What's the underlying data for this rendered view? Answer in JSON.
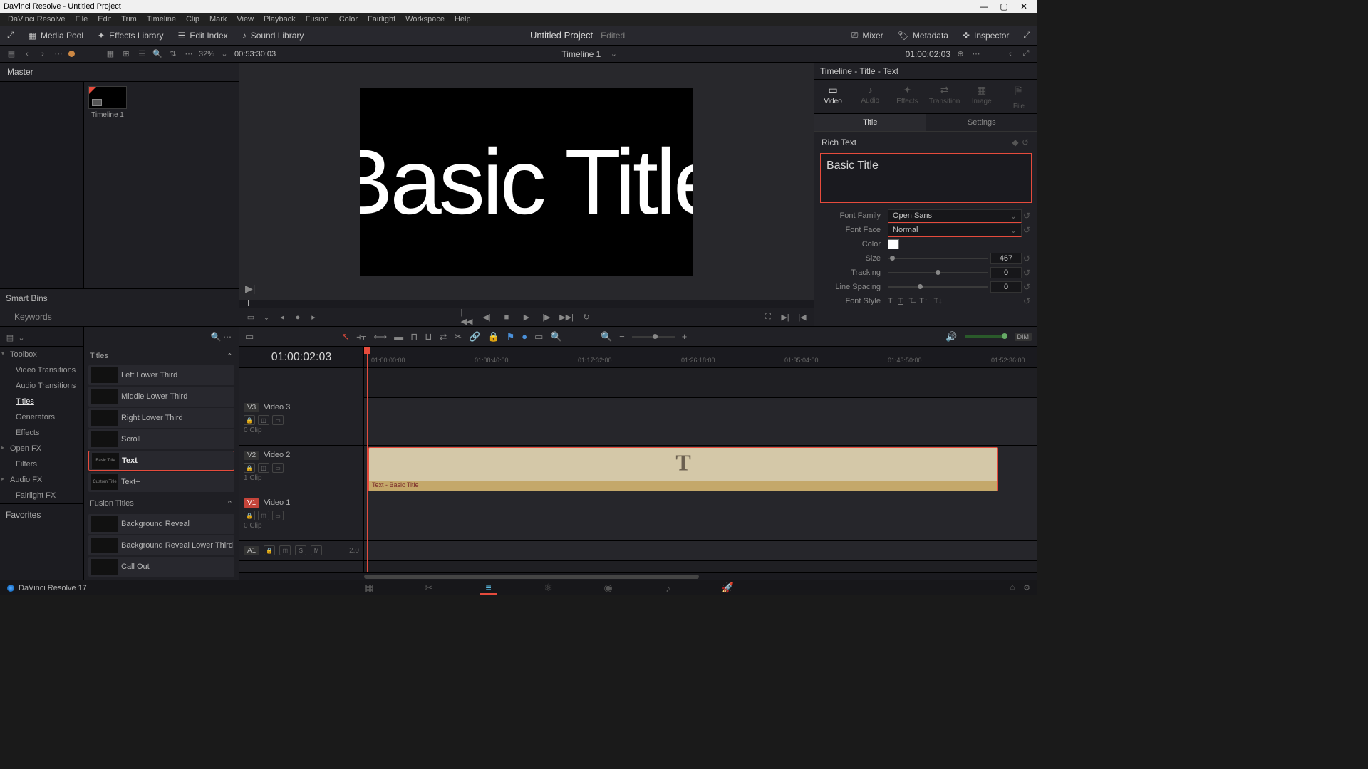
{
  "window": {
    "title": "DaVinci Resolve - Untitled Project"
  },
  "menus": [
    "DaVinci Resolve",
    "File",
    "Edit",
    "Trim",
    "Timeline",
    "Clip",
    "Mark",
    "View",
    "Playback",
    "Fusion",
    "Color",
    "Fairlight",
    "Workspace",
    "Help"
  ],
  "panels": {
    "mediaPool": "Media Pool",
    "effectsLibrary": "Effects Library",
    "editIndex": "Edit Index",
    "soundLibrary": "Sound Library",
    "mixer": "Mixer",
    "metadata": "Metadata",
    "inspector": "Inspector"
  },
  "project": {
    "title": "Untitled Project",
    "edited": "Edited"
  },
  "sourceViewer": {
    "zoom": "32%",
    "timecode": "00:53:30:03"
  },
  "timelineViewer": {
    "name": "Timeline 1",
    "timecode": "01:00:02:03",
    "displayText": "Basic Title"
  },
  "mediaPool": {
    "master": "Master",
    "thumb": {
      "label": "Timeline 1"
    },
    "smartBins": "Smart Bins",
    "keywords": "Keywords"
  },
  "fxTree": {
    "toolbox": "Toolbox",
    "videoTransitions": "Video Transitions",
    "audioTransitions": "Audio Transitions",
    "titles": "Titles",
    "generators": "Generators",
    "effects": "Effects",
    "openFX": "Open FX",
    "filters": "Filters",
    "audioFX": "Audio FX",
    "fairlightFX": "Fairlight FX",
    "favorites": "Favorites"
  },
  "fxList": {
    "headTitles": "Titles",
    "headFusion": "Fusion Titles",
    "items": [
      {
        "name": "Left Lower Third",
        "thumb": ""
      },
      {
        "name": "Middle Lower Third",
        "thumb": ""
      },
      {
        "name": "Right Lower Third",
        "thumb": ""
      },
      {
        "name": "Scroll",
        "thumb": ""
      },
      {
        "name": "Text",
        "thumb": "Basic Title",
        "selected": true
      },
      {
        "name": "Text+",
        "thumb": "Custom Title"
      }
    ],
    "fusion": [
      {
        "name": "Background Reveal"
      },
      {
        "name": "Background Reveal Lower Third"
      },
      {
        "name": "Call Out"
      }
    ]
  },
  "inspector": {
    "header": "Timeline - Title - Text",
    "tabs": [
      "Video",
      "Audio",
      "Effects",
      "Transition",
      "Image",
      "File"
    ],
    "subtabs": {
      "title": "Title",
      "settings": "Settings"
    },
    "richText": "Rich Text",
    "textValue": "Basic Title",
    "fontFamily": {
      "label": "Font Family",
      "value": "Open Sans"
    },
    "fontFace": {
      "label": "Font Face",
      "value": "Normal"
    },
    "color": {
      "label": "Color"
    },
    "size": {
      "label": "Size",
      "value": "467"
    },
    "tracking": {
      "label": "Tracking",
      "value": "0"
    },
    "lineSpacing": {
      "label": "Line Spacing",
      "value": "0"
    },
    "fontStyle": {
      "label": "Font Style"
    }
  },
  "timeline": {
    "timecode": "01:00:02:03",
    "ruler": [
      "01:00:00:00",
      "01:08:46:00",
      "01:17:32:00",
      "01:26:18:00",
      "01:35:04:00",
      "01:43:50:00",
      "01:52:36:00"
    ],
    "tracks": {
      "v3": {
        "label": "V3",
        "name": "Video 3",
        "clips": "0 Clip"
      },
      "v2": {
        "label": "V2",
        "name": "Video 2",
        "clips": "1 Clip"
      },
      "v1": {
        "label": "V1",
        "name": "Video 1",
        "clips": "0 Clip"
      },
      "a1": {
        "label": "A1",
        "gain": "2.0"
      }
    },
    "clip": {
      "label": "Text - Basic Title"
    }
  },
  "dim": "DIM",
  "status": {
    "version": "DaVinci Resolve 17"
  }
}
